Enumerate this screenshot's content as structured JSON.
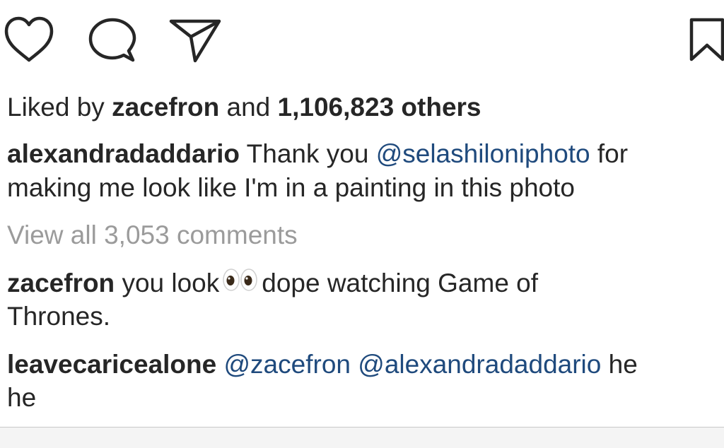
{
  "actions": {
    "like_icon": "heart-icon",
    "comment_icon": "comment-bubble-icon",
    "share_icon": "paper-plane-icon",
    "save_icon": "bookmark-icon"
  },
  "likes": {
    "prefix": "Liked by",
    "user": "zacefron",
    "joiner": "and",
    "count": "1,106,823 others"
  },
  "caption": {
    "username": "alexandradaddario",
    "text_before": "Thank you",
    "mention": "@selashiloniphoto",
    "text_after": "for",
    "line2": "making me look like I'm in a painting in this photo"
  },
  "view_all": "View all 3,053 comments",
  "comments": [
    {
      "username": "zacefron",
      "before_emoji": "you look",
      "emoji": "eyes-emoji",
      "after_emoji": "dope watching Game of",
      "line2": "Thrones."
    },
    {
      "username": "leavecaricealone",
      "mention1": "@zacefron",
      "mention2": "@alexandradaddario",
      "after": "he",
      "line2": "he"
    }
  ],
  "colors": {
    "text": "#262626",
    "mention": "#1f4a7d",
    "muted": "#9b9b9b"
  }
}
